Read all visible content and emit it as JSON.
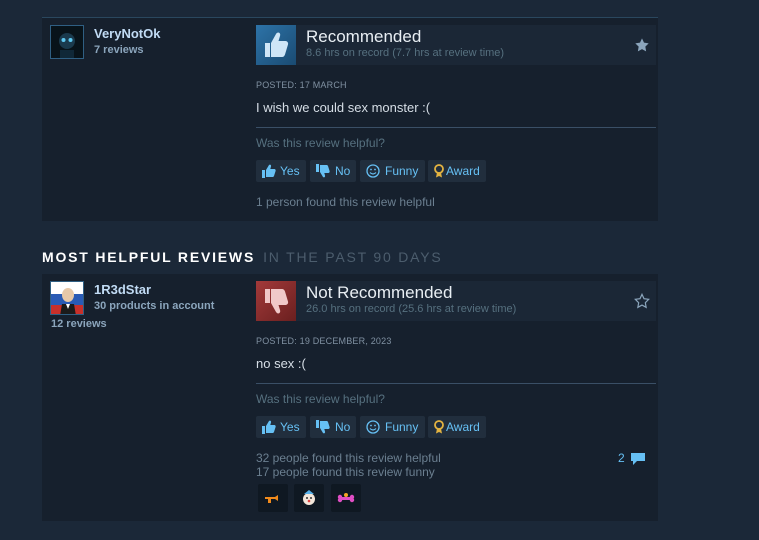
{
  "reviews": [
    {
      "author": {
        "name": "VeryNotOk",
        "sub": "7 reviews",
        "sub2": ""
      },
      "vote": {
        "title": "Recommended",
        "hours": "8.6 hrs on record (7.7 hrs at review time)",
        "recommended": true,
        "starred": true
      },
      "posted": "POSTED: 17 MARCH",
      "content": "I wish we could sex monster :(",
      "helpful_question": "Was this review helpful?",
      "buttons": {
        "yes": "Yes",
        "no": "No",
        "funny": "Funny",
        "award": "Award"
      },
      "found_helpful": "1 person found this review helpful",
      "found_funny": ""
    },
    {
      "author": {
        "name": "1R3dStar",
        "sub": "30 products in account",
        "sub2": "12 reviews"
      },
      "vote": {
        "title": "Not Recommended",
        "hours": "26.0 hrs on record (25.6 hrs at review time)",
        "recommended": false,
        "starred": false
      },
      "posted": "POSTED: 19 DECEMBER, 2023",
      "content": "no sex :(",
      "helpful_question": "Was this review helpful?",
      "buttons": {
        "yes": "Yes",
        "no": "No",
        "funny": "Funny",
        "award": "Award"
      },
      "found_helpful": "32 people found this review helpful",
      "found_funny": "17 people found this review funny",
      "comments_count": "2",
      "awards": [
        "sword-award-icon",
        "clown-award-icon",
        "bone-award-icon"
      ]
    }
  ],
  "section": {
    "title": "MOST HELPFUL REVIEWS",
    "subtitle": "IN THE PAST 90 DAYS"
  },
  "colors": {
    "background": "#1b2838",
    "panel": "#16202d",
    "link": "#66c0f4",
    "thumb_up": "#2d73a8",
    "thumb_down": "#a33a3a"
  }
}
